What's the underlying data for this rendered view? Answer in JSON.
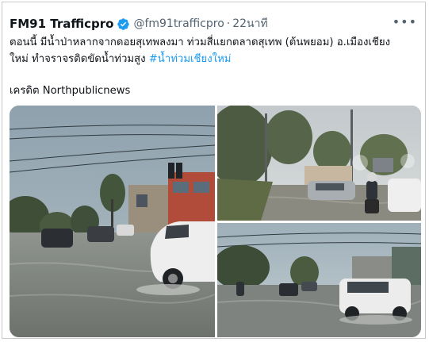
{
  "tweet": {
    "author_name": "FM91 Trafficpro",
    "handle": "@fm91trafficpro",
    "separator": "·",
    "time": "22นาที",
    "more_label": "•••",
    "text_line1": "ตอนนี้ มีน้ำป่าหลากจากดอยสุเทพลงมา ท่วมสี่แยกตลาดสุเทพ (ต้นพยอม) อ.เมืองเชียง",
    "text_line2_prefix": "ใหม่ ทำจราจรติดขัดน้ำท่วมสูง ",
    "hashtag": "#น้ำท่วมเชียงใหม่",
    "credit": "เครดิต Northpublicnews"
  },
  "colors": {
    "verified_badge": "#1d9bf0",
    "hashtag": "#1d9bf0",
    "text": "#0f1419",
    "secondary_text": "#536471"
  },
  "media": {
    "photos": [
      {
        "name": "flooded-road-photo-1"
      },
      {
        "name": "flooded-intersection-photo-2"
      },
      {
        "name": "flooded-road-photo-3"
      }
    ]
  }
}
